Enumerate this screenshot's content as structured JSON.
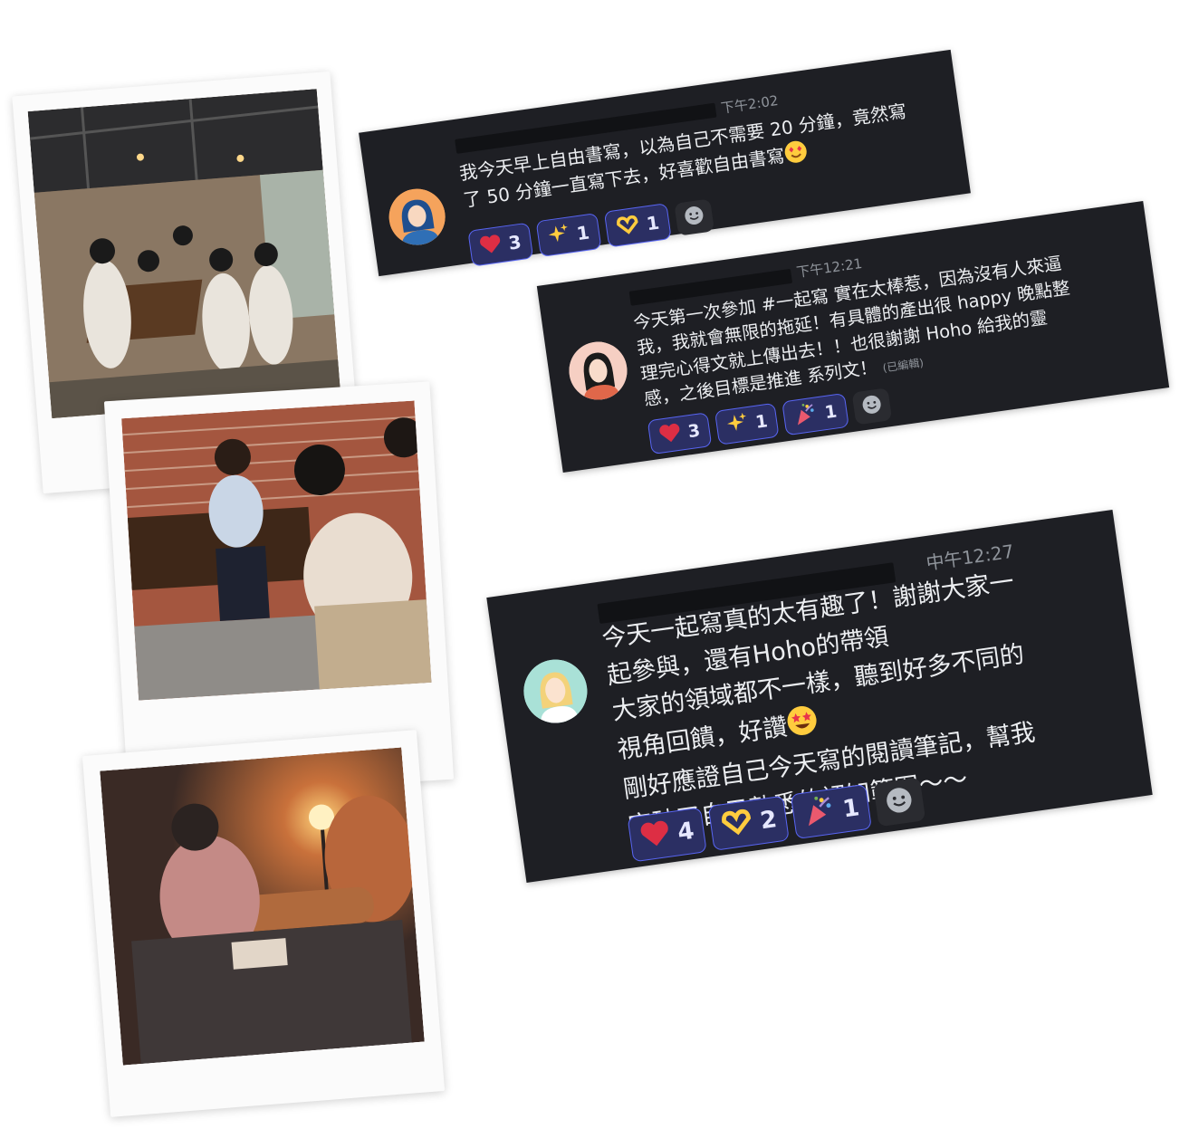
{
  "messages": [
    {
      "timestamp": "下午2:02",
      "lines": [
        "我今天早上自由書寫，以為自己不需要 20 分鐘，竟然寫",
        "了 50 分鐘一直寫下去，好喜歡自由書寫"
      ],
      "edited": "",
      "reactions": [
        {
          "icon": "heart-icon",
          "count": "3"
        },
        {
          "icon": "sparkles-icon",
          "count": "1"
        },
        {
          "icon": "heart-hands-icon",
          "count": "1"
        }
      ]
    },
    {
      "timestamp": "下午12:21",
      "lines": [
        "今天第一次參加 #一起寫 實在太棒惹，因為沒有人來逼",
        "我，我就會無限的拖延！有具體的產出很 happy 晚點整",
        "理完心得文就上傳出去！！也很謝謝 Hoho 給我的靈",
        "感，之後目標是推進 系列文！"
      ],
      "edited": "(已編輯)",
      "reactions": [
        {
          "icon": "heart-icon",
          "count": "3"
        },
        {
          "icon": "sparkles-icon",
          "count": "1"
        },
        {
          "icon": "party-popper-icon",
          "count": "1"
        }
      ]
    },
    {
      "timestamp": "中午12:27",
      "lines": [
        "今天一起寫真的太有趣了！謝謝大家一",
        "起參與，還有Hoho的帶領",
        "大家的領域都不一樣，聽到好多不同的",
        "視角回饋，好讚",
        "剛好應證自己今天寫的閱讀筆記，幫我",
        "突破了自己熟悉的認知範圍～～"
      ],
      "edited": "",
      "reactions": [
        {
          "icon": "heart-icon",
          "count": "4"
        },
        {
          "icon": "heart-hands-icon",
          "count": "2"
        },
        {
          "icon": "party-popper-icon",
          "count": "1"
        }
      ]
    }
  ],
  "colors": {
    "card_bg": "#1e1f24",
    "reaction_bg": "#2b2f63",
    "reaction_border": "#5865f2"
  }
}
